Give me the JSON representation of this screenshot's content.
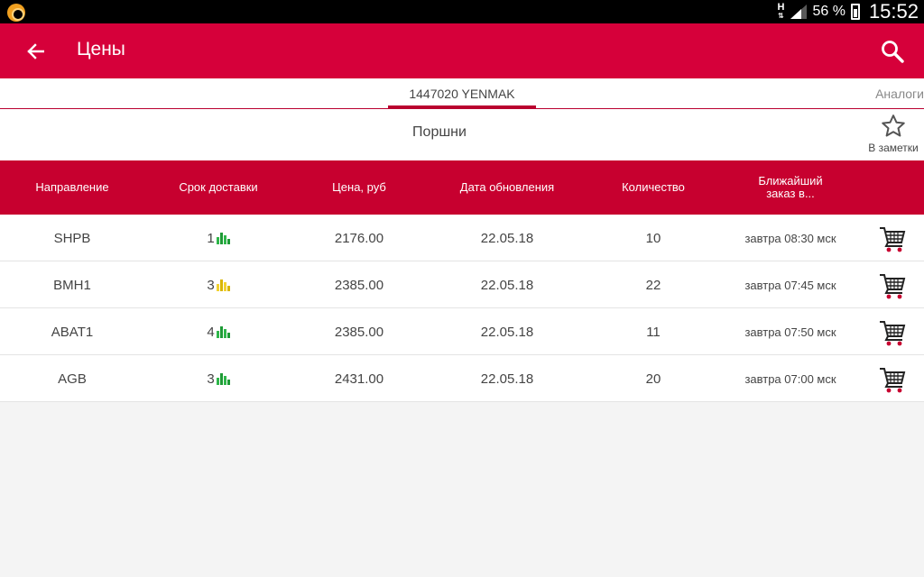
{
  "status_bar": {
    "network": "H",
    "battery_percent": "56 %",
    "time": "15:52"
  },
  "app_bar": {
    "title": "Цены",
    "back_icon": "arrow-left-icon",
    "search_icon": "search-icon",
    "color": "#d6003a"
  },
  "tabs": {
    "main": "1447020 YENMAK",
    "analogs": "Аналоги"
  },
  "subheader": {
    "title": "Поршни",
    "favorite_label": "В заметки",
    "favorite_icon": "star-outline-icon"
  },
  "table": {
    "header_color": "#c7002f",
    "columns": [
      "Направление",
      "Срок доставки",
      "Цена, руб",
      "Дата обновления",
      "Количество",
      "Ближайший заказ в..."
    ],
    "rows": [
      {
        "direction": "SHPB",
        "delivery": "1",
        "reliability": "green",
        "price": "2176.00",
        "date": "22.05.18",
        "quantity": "10",
        "next_order": "завтра 08:30 мск"
      },
      {
        "direction": "BMH1",
        "delivery": "3",
        "reliability": "yellow",
        "price": "2385.00",
        "date": "22.05.18",
        "quantity": "22",
        "next_order": "завтра 07:45 мск"
      },
      {
        "direction": "ABAT1",
        "delivery": "4",
        "reliability": "green",
        "price": "2385.00",
        "date": "22.05.18",
        "quantity": "11",
        "next_order": "завтра 07:50 мск"
      },
      {
        "direction": "AGB",
        "delivery": "3",
        "reliability": "green",
        "price": "2431.00",
        "date": "22.05.18",
        "quantity": "20",
        "next_order": "завтра 07:00 мск"
      }
    ]
  }
}
